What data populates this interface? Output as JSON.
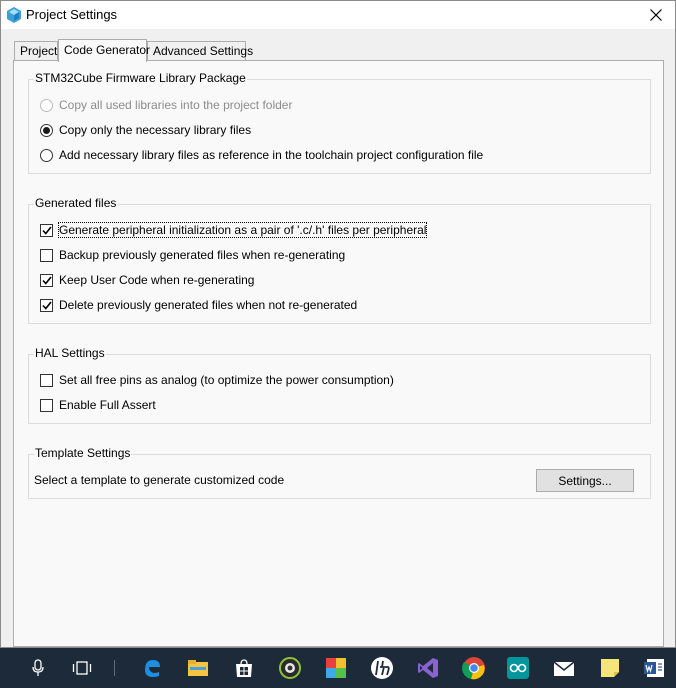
{
  "window": {
    "title": "Project Settings"
  },
  "tabs": [
    {
      "label": "Project",
      "active": false
    },
    {
      "label": "Code Generator",
      "active": true
    },
    {
      "label": "Advanced Settings",
      "active": false
    }
  ],
  "firmware_group": {
    "title": "STM32Cube Firmware Library Package",
    "options": [
      {
        "label": "Copy all used libraries into the project folder",
        "selected": false,
        "disabled": true
      },
      {
        "label": "Copy only the necessary library files",
        "selected": true,
        "disabled": false
      },
      {
        "label": "Add necessary library files as reference in the toolchain project configuration file",
        "selected": false,
        "disabled": false
      }
    ]
  },
  "generated_files_group": {
    "title": "Generated files",
    "options": [
      {
        "label": "Generate peripheral initialization as a pair of '.c/.h' files per peripheral",
        "checked": true
      },
      {
        "label": "Backup previously generated files when re-generating",
        "checked": false
      },
      {
        "label": "Keep User Code when re-generating",
        "checked": true
      },
      {
        "label": "Delete previously generated files when not re-generated",
        "checked": true
      }
    ]
  },
  "hal_group": {
    "title": "HAL Settings",
    "options": [
      {
        "label": "Set all free pins as analog (to optimize the power consumption)",
        "checked": false
      },
      {
        "label": "Enable Full Assert",
        "checked": false
      }
    ]
  },
  "template_group": {
    "title": "Template Settings",
    "description": "Select a template to generate customized code",
    "button_label": "Settings..."
  },
  "taskbar": {
    "background": "#1c2a3a",
    "items": [
      "microphone-icon",
      "task-view-icon",
      "edge-icon",
      "file-explorer-icon",
      "store-icon",
      "camera-app-icon",
      "paint-app-icon",
      "hp-icon",
      "visual-studio-icon",
      "chrome-icon",
      "arduino-icon",
      "mail-icon",
      "sticky-notes-icon",
      "word-icon"
    ]
  }
}
